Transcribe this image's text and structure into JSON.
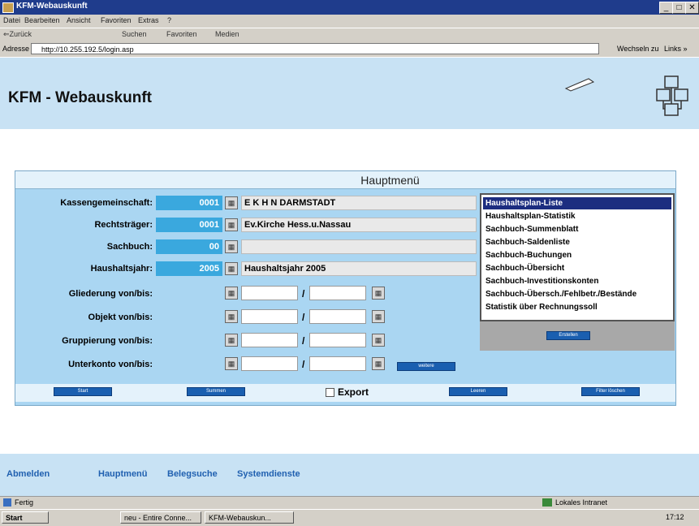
{
  "window": {
    "title": "KFM-Webauskunft",
    "controls": [
      "_",
      "□",
      "✕"
    ]
  },
  "menubar": [
    "Datei",
    "Bearbeiten",
    "Ansicht",
    "Favoriten",
    "Extras",
    "?"
  ],
  "toolbar": [
    "⇐Zurück",
    "Suchen",
    "Favoriten",
    "Medien"
  ],
  "address": {
    "label": "Adresse",
    "url": "http://10.255.192.5/login.asp",
    "go": "Wechseln zu",
    "links": "Links »"
  },
  "app": {
    "title": "KFM - Webauskunft"
  },
  "panel": {
    "title": "Hauptmenü"
  },
  "fields": {
    "kasse": {
      "label": "Kassengemeinschaft:",
      "code": "0001",
      "desc": "E K H N  DARMSTADT"
    },
    "rechtstraeger": {
      "label": "Rechtsträger:",
      "code": "0001",
      "desc": "Ev.Kirche Hess.u.Nassau"
    },
    "sachbuch": {
      "label": "Sachbuch:",
      "code": "00",
      "desc": ""
    },
    "haushaltsjahr": {
      "label": "Haushaltsjahr:",
      "code": "2005",
      "desc": "Haushaltsjahr 2005"
    }
  },
  "ranges": [
    {
      "label": "Gliederung von/bis:"
    },
    {
      "label": "Objekt von/bis:"
    },
    {
      "label": "Gruppierung von/bis:"
    },
    {
      "label": "Unterkonto von/bis:"
    }
  ],
  "range_sep": "/",
  "buttons": {
    "weitere": "weitere",
    "erstellen": "Erstellen",
    "start": "Start",
    "summen": "Summen",
    "leeren": "Leeren",
    "filter": "Filter löschen"
  },
  "export_label": "Export",
  "list": [
    "Haushaltsplan-Liste",
    "Haushaltsplan-Statistik",
    "Sachbuch-Summenblatt",
    "Sachbuch-Saldenliste",
    "Sachbuch-Buchungen",
    "Sachbuch-Übersicht",
    "Sachbuch-Investitionskonten",
    "Sachbuch-Übersch./Fehlbetr./Bestände",
    "Statistik über Rechnungssoll"
  ],
  "footer": {
    "abmelden": "Abmelden",
    "hauptmenu": "Hauptmenü",
    "belegsuche": "Belegsuche",
    "systemdienste": "Systemdienste"
  },
  "status": {
    "left": "Fertig",
    "zone": "Lokales Intranet"
  },
  "taskbar": {
    "start": "Start",
    "task1": "neu - Entire Conne...",
    "task2": "KFM-Webauskun...",
    "time": "17:12"
  }
}
